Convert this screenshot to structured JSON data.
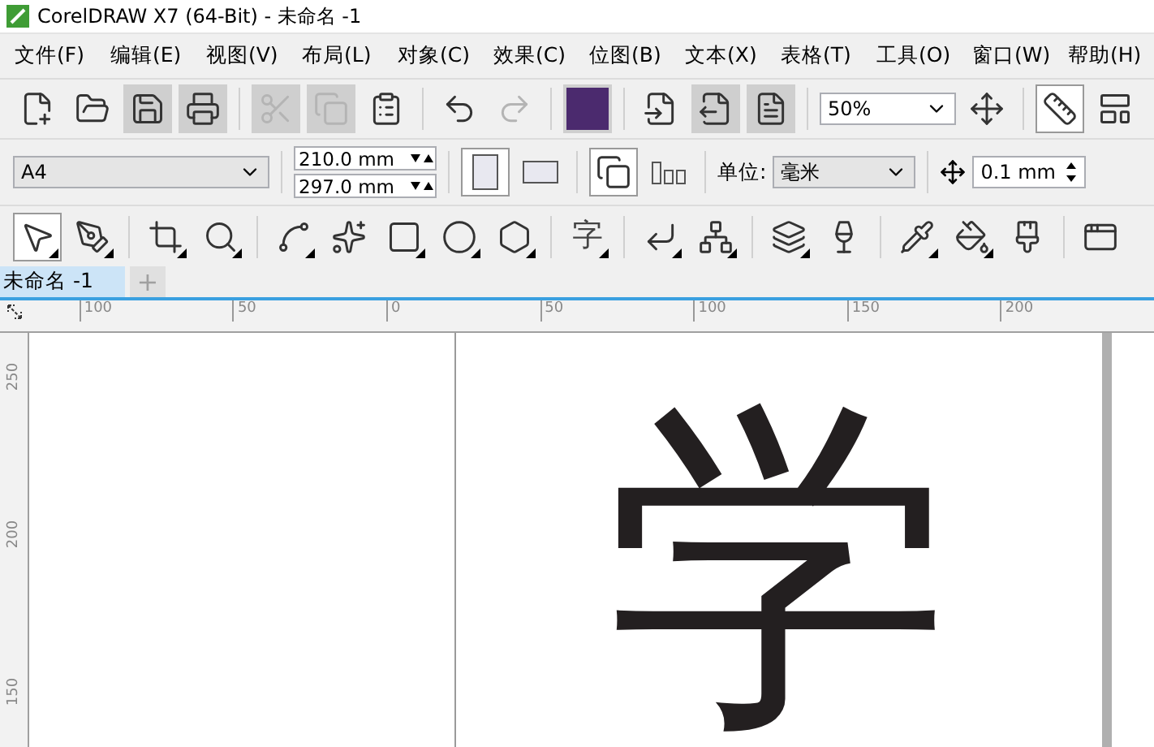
{
  "window": {
    "title": "CorelDRAW X7 (64-Bit) - 未命名 -1"
  },
  "menu": [
    "文件(F)",
    "编辑(E)",
    "视图(V)",
    "布局(L)",
    "对象(C)",
    "效果(C)",
    "位图(B)",
    "文本(X)",
    "表格(T)",
    "工具(O)",
    "窗口(W)",
    "帮助(H)"
  ],
  "standard_toolbar": [
    {
      "kind": "new",
      "disabled": false,
      "pressed": false
    },
    {
      "kind": "open",
      "disabled": false,
      "pressed": false
    },
    {
      "kind": "save",
      "disabled": false,
      "pressed": true
    },
    {
      "kind": "print",
      "disabled": false,
      "pressed": true
    },
    {
      "kind": "cut",
      "disabled": true,
      "pressed": true
    },
    {
      "kind": "copy",
      "disabled": true,
      "pressed": true
    },
    {
      "kind": "paste",
      "disabled": false,
      "pressed": false
    },
    {
      "kind": "undo",
      "disabled": false,
      "pressed": false
    },
    {
      "kind": "redo",
      "disabled": true,
      "pressed": false
    },
    {
      "kind": "launch",
      "disabled": false,
      "pressed": true
    },
    {
      "kind": "import",
      "disabled": false,
      "pressed": false
    },
    {
      "kind": "export",
      "disabled": false,
      "pressed": true
    },
    {
      "kind": "pdf",
      "disabled": false,
      "pressed": true
    }
  ],
  "zoom": {
    "value": "50%"
  },
  "property_bar": {
    "paper_size": "A4",
    "width": "210.0 mm",
    "height": "297.0 mm",
    "orientation": [
      {
        "kind": "portrait",
        "selected": true
      },
      {
        "kind": "landscape",
        "selected": false
      }
    ],
    "units_label": "单位:",
    "units": "毫米",
    "nudge": "0.1 mm"
  },
  "toolbox": [
    {
      "kind": "pick",
      "selected": true,
      "flyout": true
    },
    {
      "kind": "shape",
      "selected": false,
      "flyout": true
    },
    {
      "kind": "crop",
      "selected": false,
      "flyout": true
    },
    {
      "kind": "zoom",
      "selected": false,
      "flyout": true
    },
    {
      "kind": "line",
      "selected": false,
      "flyout": true
    },
    {
      "kind": "curve",
      "selected": false,
      "flyout": false
    },
    {
      "kind": "rectangle",
      "selected": false,
      "flyout": true
    },
    {
      "kind": "ellipse",
      "selected": false,
      "flyout": true
    },
    {
      "kind": "polygon",
      "selected": false,
      "flyout": true
    },
    {
      "kind": "text",
      "glyph": "字",
      "selected": false,
      "flyout": true
    },
    {
      "kind": "connector",
      "selected": false,
      "flyout": true
    },
    {
      "kind": "blend",
      "selected": false,
      "flyout": true
    },
    {
      "kind": "shadow",
      "selected": false,
      "flyout": true
    },
    {
      "kind": "transparency",
      "selected": false,
      "flyout": false
    },
    {
      "kind": "eyedropper",
      "selected": false,
      "flyout": true
    },
    {
      "kind": "fill",
      "selected": false,
      "flyout": true
    },
    {
      "kind": "smartfill",
      "selected": false,
      "flyout": false
    },
    {
      "kind": "window",
      "selected": false,
      "flyout": false
    }
  ],
  "document_tabs": [
    {
      "label": "未命名 -1",
      "selected": true
    }
  ],
  "add_tab": "+",
  "horizontal_ruler": [
    "100",
    "50",
    "0",
    "50",
    "100",
    "150",
    "200"
  ],
  "vertical_ruler": [
    "250",
    "200",
    "150"
  ],
  "canvas": {
    "text": "学"
  }
}
